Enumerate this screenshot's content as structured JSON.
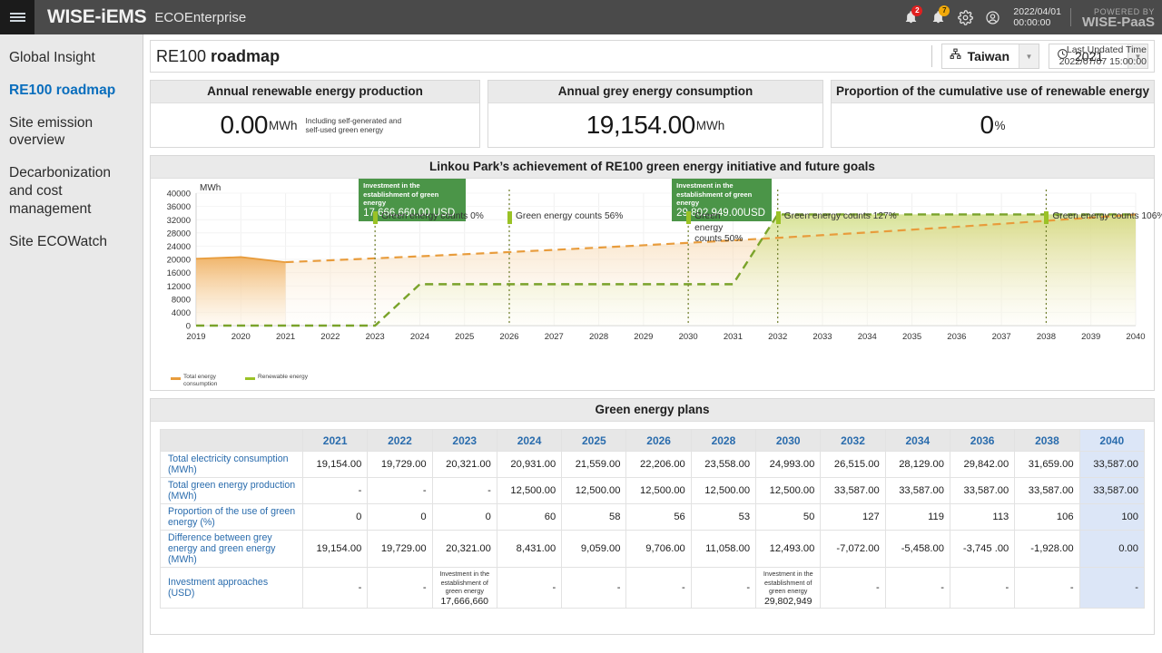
{
  "topbar": {
    "menu_icon": "hamburger-icon",
    "brand": "WISE-iEMS",
    "product": "ECOEnterprise",
    "alert_badge": "2",
    "notify_badge": "7",
    "timestamp_date": "2022/04/01",
    "timestamp_time": "00:00:00",
    "powered_label": "POWERED BY",
    "powered_brand": "WISE-PaaS"
  },
  "sidebar": {
    "items": [
      {
        "label": "Global Insight",
        "active": false
      },
      {
        "label": "RE100 roadmap",
        "active": true
      },
      {
        "label": "Site emission overview",
        "active": false
      },
      {
        "label": "Decarbonization and cost management",
        "active": false
      },
      {
        "label": "Site ECOWatch",
        "active": false
      }
    ]
  },
  "toolbar": {
    "title_prefix": "RE100",
    "title_bold": "roadmap",
    "site_selector": {
      "icon": "hierarchy-icon",
      "value": "Taiwan"
    },
    "year_selector": {
      "icon": "clock-icon",
      "value": "2021"
    },
    "updated_label": "Last Updated Time",
    "updated_value": "2022/07/07 15:00:00"
  },
  "kpi": [
    {
      "title": "Annual renewable energy production",
      "value": "0.00",
      "unit": "MWh",
      "note": "Including self-generated and self-used green energy"
    },
    {
      "title": "Annual grey energy consumption",
      "value": "19,154.00",
      "unit": "MWh",
      "note": ""
    },
    {
      "title": "Proportion of the cumulative use of renewable energy",
      "value": "0",
      "unit": "%",
      "note": ""
    }
  ],
  "chart_panel_title": "Linkou Park’s achievement of RE100  green energy initiative and future goals",
  "chart_data": {
    "type": "area",
    "title": "Linkou Park’s achievement of RE100  green energy initiative and future goals",
    "ylabel": "MWh",
    "ylim": [
      0,
      40000
    ],
    "yticks": [
      0,
      4000,
      8000,
      12000,
      16000,
      20000,
      24000,
      28000,
      32000,
      36000,
      40000
    ],
    "x": [
      2019,
      2020,
      2021,
      2022,
      2023,
      2024,
      2025,
      2026,
      2027,
      2028,
      2029,
      2030,
      2031,
      2032,
      2033,
      2034,
      2035,
      2036,
      2037,
      2038,
      2039,
      2040
    ],
    "grid": true,
    "legend_position": "bottom-left",
    "series": [
      {
        "name": "Total energy consumption",
        "color": "#e89c3c",
        "style": "solid-then-dashed",
        "solid_until": 2021,
        "values": [
          20200,
          20700,
          19154,
          19729,
          20321,
          20931,
          21559,
          22206,
          22880,
          23558,
          24270,
          24993,
          25750,
          26515,
          27320,
          28129,
          28980,
          29842,
          30740,
          31659,
          32610,
          33587
        ]
      },
      {
        "name": "Renewable energy",
        "color": "#7aa32b",
        "style": "dashed",
        "values": [
          0,
          0,
          0,
          0,
          0,
          12500,
          12500,
          12500,
          12500,
          12500,
          12500,
          12500,
          12500,
          33587,
          33587,
          33587,
          33587,
          33587,
          33587,
          33587,
          33587,
          33587
        ]
      }
    ],
    "investment_badges": [
      {
        "at_year": 2023,
        "line1": "Investment in the",
        "line2": "establishment of green energy",
        "amount": "17,666,660.00 USD"
      },
      {
        "at_year": 2030,
        "line1": "Investment in the establishment",
        "line2": "of green energy",
        "amount": "29,802,949.00USD"
      }
    ],
    "annotations": [
      {
        "at_year": 2023,
        "text": "Green energy counts 0%"
      },
      {
        "at_year": 2026,
        "text": "Green energy counts 56%"
      },
      {
        "at_year": 2030,
        "text": "Green energy counts 50%"
      },
      {
        "at_year": 2032,
        "text": "Green energy counts 127%"
      },
      {
        "at_year": 2038,
        "text": "Green energy counts 106%"
      }
    ]
  },
  "table": {
    "title": "Green energy plans",
    "row_header_label": "",
    "columns": [
      "2021",
      "2022",
      "2023",
      "2024",
      "2025",
      "2026",
      "2028",
      "2030",
      "2032",
      "2034",
      "2036",
      "2038",
      "2040"
    ],
    "highlight_column": "2040",
    "rows": [
      {
        "label": "Total electricity consumption (MWh)",
        "values": [
          "19,154.00",
          "19,729.00",
          "20,321.00",
          "20,931.00",
          "21,559.00",
          "22,206.00",
          "23,558.00",
          "24,993.00",
          "26,515.00",
          "28,129.00",
          "29,842.00",
          "31,659.00",
          "33,587.00"
        ]
      },
      {
        "label": "Total green energy production (MWh)",
        "values": [
          "-",
          "-",
          "-",
          "12,500.00",
          "12,500.00",
          "12,500.00",
          "12,500.00",
          "12,500.00",
          "33,587.00",
          "33,587.00",
          "33,587.00",
          "33,587.00",
          "33,587.00"
        ]
      },
      {
        "label": "Proportion of the use of green energy (%)",
        "values": [
          "0",
          "0",
          "0",
          "60",
          "58",
          "56",
          "53",
          "50",
          "127",
          "119",
          "113",
          "106",
          "100"
        ]
      },
      {
        "label": "Difference between grey energy and green energy (MWh)",
        "values": [
          "19,154.00",
          "19,729.00",
          "20,321.00",
          "8,431.00",
          "9,059.00",
          "9,706.00",
          "11,058.00",
          "12,493.00",
          "-7,072.00",
          "-5,458.00",
          "-3,745 .00",
          "-1,928.00",
          "0.00"
        ]
      }
    ],
    "investment_row": {
      "label": "Investment approaches (USD)",
      "cells": [
        {
          "type": "dash",
          "text": "-"
        },
        {
          "type": "dash",
          "text": "-"
        },
        {
          "type": "note",
          "note": "Investment in the establishment of green energy",
          "amount": "17,666,660"
        },
        {
          "type": "dash",
          "text": "-"
        },
        {
          "type": "dash",
          "text": "-"
        },
        {
          "type": "dash",
          "text": "-"
        },
        {
          "type": "dash",
          "text": "-"
        },
        {
          "type": "note",
          "note": "Investment in the establishment of green energy",
          "amount": "29,802,949"
        },
        {
          "type": "dash",
          "text": "-"
        },
        {
          "type": "dash",
          "text": "-"
        },
        {
          "type": "dash",
          "text": "-"
        },
        {
          "type": "dash",
          "text": "-"
        },
        {
          "type": "dash",
          "text": "-"
        }
      ]
    }
  }
}
